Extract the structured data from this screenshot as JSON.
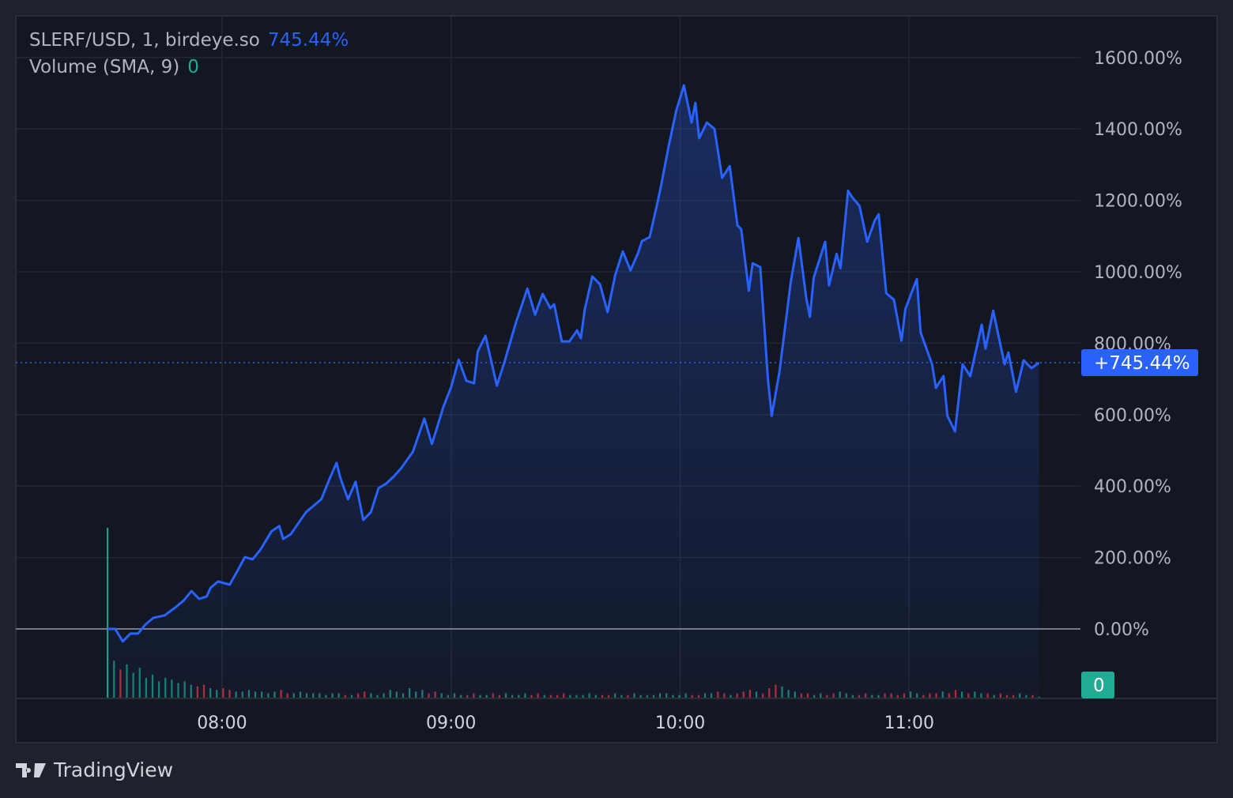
{
  "legend": {
    "symbol": "SLERF/USD, 1, birdeye.so",
    "last_value": "745.44%",
    "volume_label": "Volume (SMA, 9)",
    "volume_value": "0"
  },
  "brand": "TradingView",
  "colors": {
    "line": "#2962ff",
    "up": "#22ab94",
    "down": "#f23645",
    "bg": "#131722"
  },
  "chart_data": {
    "type": "area",
    "title": "SLERF/USD, 1, birdeye.so",
    "x_unit": "minutes since 07:30",
    "ylabel": "% change",
    "ylim": [
      -100,
      1700
    ],
    "y_ticks": [
      0,
      200,
      400,
      600,
      800,
      1000,
      1200,
      1400,
      1600
    ],
    "y_tick_labels": [
      "0.00%",
      "200.00%",
      "400.00%",
      "600.00%",
      "800.00%",
      "1000.00%",
      "1200.00%",
      "1400.00%",
      "1600.00%"
    ],
    "x_ticks": [
      30,
      90,
      150,
      210
    ],
    "x_tick_labels": [
      "08:00",
      "09:00",
      "10:00",
      "11:00"
    ],
    "last_label": "+745.44%",
    "volume_last_label": "0",
    "series": [
      {
        "name": "SLERF/USD",
        "points": [
          [
            0,
            0
          ],
          [
            2,
            0
          ],
          [
            4,
            -35
          ],
          [
            6,
            -13
          ],
          [
            8,
            -13
          ],
          [
            10,
            13
          ],
          [
            12,
            31
          ],
          [
            15,
            38
          ],
          [
            18,
            62
          ],
          [
            20,
            80
          ],
          [
            22,
            106
          ],
          [
            24,
            84
          ],
          [
            26,
            91
          ],
          [
            27,
            115
          ],
          [
            29,
            133
          ],
          [
            32,
            124
          ],
          [
            34,
            162
          ],
          [
            36,
            201
          ],
          [
            38,
            195
          ],
          [
            40,
            221
          ],
          [
            43,
            274
          ],
          [
            45,
            288
          ],
          [
            46,
            252
          ],
          [
            48,
            265
          ],
          [
            52,
            327
          ],
          [
            54,
            345
          ],
          [
            56,
            363
          ],
          [
            58,
            416
          ],
          [
            60,
            465
          ],
          [
            61,
            423
          ],
          [
            63,
            363
          ],
          [
            65,
            412
          ],
          [
            67,
            305
          ],
          [
            69,
            327
          ],
          [
            71,
            394
          ],
          [
            73,
            407
          ],
          [
            75,
            427
          ],
          [
            77,
            451
          ],
          [
            80,
            496
          ],
          [
            83,
            589
          ],
          [
            85,
            518
          ],
          [
            88,
            622
          ],
          [
            90,
            677
          ],
          [
            92,
            754
          ],
          [
            94,
            695
          ],
          [
            96,
            688
          ],
          [
            97,
            777
          ],
          [
            99,
            821
          ],
          [
            102,
            681
          ],
          [
            104,
            748
          ],
          [
            107,
            858
          ],
          [
            110,
            953
          ],
          [
            112,
            880
          ],
          [
            114,
            938
          ],
          [
            116,
            898
          ],
          [
            117,
            909
          ],
          [
            119,
            805
          ],
          [
            121,
            805
          ],
          [
            123,
            836
          ],
          [
            124,
            814
          ],
          [
            125,
            894
          ],
          [
            127,
            987
          ],
          [
            129,
            965
          ],
          [
            131,
            887
          ],
          [
            133,
            991
          ],
          [
            135,
            1057
          ],
          [
            137,
            1004
          ],
          [
            139,
            1053
          ],
          [
            140,
            1086
          ],
          [
            142,
            1097
          ],
          [
            144,
            1190
          ],
          [
            145,
            1241
          ],
          [
            147,
            1352
          ],
          [
            149,
            1452
          ],
          [
            151,
            1522
          ],
          [
            153,
            1418
          ],
          [
            154,
            1473
          ],
          [
            155,
            1374
          ],
          [
            157,
            1418
          ],
          [
            159,
            1400
          ],
          [
            161,
            1263
          ],
          [
            163,
            1296
          ],
          [
            165,
            1130
          ],
          [
            166,
            1119
          ],
          [
            168,
            947
          ],
          [
            169,
            1024
          ],
          [
            171,
            1013
          ],
          [
            173,
            699
          ],
          [
            174,
            597
          ],
          [
            176,
            719
          ],
          [
            179,
            973
          ],
          [
            181,
            1095
          ],
          [
            183,
            929
          ],
          [
            184,
            874
          ],
          [
            185,
            984
          ],
          [
            188,
            1084
          ],
          [
            189,
            962
          ],
          [
            191,
            1050
          ],
          [
            192,
            1010
          ],
          [
            194,
            1227
          ],
          [
            195,
            1210
          ],
          [
            197,
            1184
          ],
          [
            199,
            1084
          ],
          [
            201,
            1144
          ],
          [
            202,
            1161
          ],
          [
            204,
            940
          ],
          [
            206,
            922
          ],
          [
            208,
            807
          ],
          [
            209,
            896
          ],
          [
            212,
            980
          ],
          [
            213,
            830
          ],
          [
            216,
            741
          ],
          [
            217,
            675
          ],
          [
            219,
            708
          ],
          [
            220,
            597
          ],
          [
            222,
            553
          ],
          [
            224,
            741
          ],
          [
            226,
            708
          ],
          [
            229,
            852
          ],
          [
            230,
            785
          ],
          [
            232,
            891
          ],
          [
            235,
            741
          ],
          [
            236,
            774
          ],
          [
            238,
            664
          ],
          [
            240,
            752
          ],
          [
            242,
            730
          ],
          [
            244,
            745.44
          ]
        ]
      }
    ],
    "volume": {
      "name": "Volume",
      "values": [
        100,
        22,
        17,
        20,
        15,
        18,
        12,
        14,
        10,
        12,
        11,
        9,
        10,
        8,
        7,
        8,
        6,
        5,
        6,
        5,
        4,
        4,
        5,
        4,
        4,
        3,
        4,
        5,
        3,
        3,
        4,
        3,
        3,
        3,
        2,
        3,
        3,
        2,
        2,
        3,
        4,
        3,
        2,
        3,
        5,
        4,
        3,
        6,
        4,
        5,
        3,
        4,
        3,
        2,
        3,
        2,
        2,
        3,
        2,
        2,
        3,
        2,
        3,
        2,
        2,
        3,
        2,
        3,
        2,
        2,
        2,
        3,
        2,
        2,
        2,
        3,
        2,
        2,
        2,
        3,
        2,
        2,
        3,
        2,
        2,
        2,
        3,
        3,
        2,
        2,
        3,
        2,
        2,
        3,
        3,
        4,
        3,
        2,
        3,
        4,
        5,
        4,
        3,
        6,
        8,
        7,
        5,
        4,
        3,
        3,
        2,
        3,
        2,
        3,
        4,
        3,
        2,
        2,
        3,
        2,
        2,
        3,
        3,
        2,
        3,
        4,
        3,
        2,
        3,
        3,
        4,
        3,
        5,
        4,
        3,
        4,
        3,
        3,
        2,
        3,
        2,
        2,
        3,
        2,
        2,
        1
      ]
    }
  }
}
